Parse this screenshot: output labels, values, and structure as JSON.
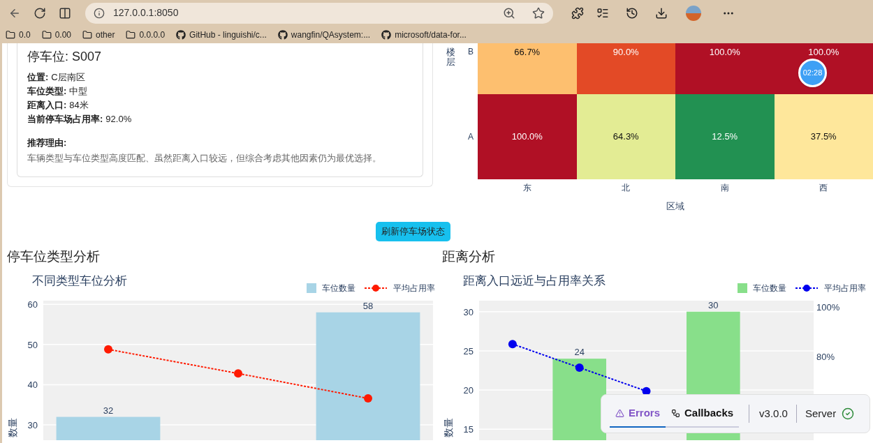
{
  "browser": {
    "url": "127.0.0.1:8050",
    "bookmarks": [
      {
        "kind": "folder",
        "label": "0.0"
      },
      {
        "kind": "folder",
        "label": "0.00"
      },
      {
        "kind": "folder",
        "label": "other"
      },
      {
        "kind": "folder",
        "label": "0.0.0.0"
      },
      {
        "kind": "github",
        "label": "GitHub - linguishi/c..."
      },
      {
        "kind": "github",
        "label": "wangfin/QAsystem:..."
      },
      {
        "kind": "github",
        "label": "microsoft/data-for..."
      }
    ]
  },
  "recommendation": {
    "title": "停车位: S007",
    "fields": [
      {
        "label": "位置:",
        "value": "C层南区"
      },
      {
        "label": "车位类型:",
        "value": "中型"
      },
      {
        "label": "距离入口:",
        "value": "84米"
      },
      {
        "label": "当前停车场占用率:",
        "value": "92.0%"
      }
    ],
    "reason_label": "推荐理由:",
    "reason": "车辆类型与车位类型高度匹配、虽然距离入口较远，但综合考虑其他因素仍为最优选择。"
  },
  "heatmap": {
    "ylabel": "楼层",
    "xlabel": "区域",
    "x_axis_labels": [
      "东",
      "北",
      "南",
      "西"
    ],
    "rows": [
      {
        "label": "B",
        "cells": [
          {
            "text": "66.7%",
            "color": "#fdbf6f"
          },
          {
            "text": "90.0%",
            "color": "#e34a26"
          },
          {
            "text": "100.0%",
            "color": "#b01025"
          },
          {
            "text": "100.0%",
            "color": "#b01025"
          }
        ]
      },
      {
        "label": "A",
        "cells": [
          {
            "text": "100.0%",
            "color": "#b01025"
          },
          {
            "text": "64.3%",
            "color": "#e3ec94"
          },
          {
            "text": "12.5%",
            "color": "#229152"
          },
          {
            "text": "37.5%",
            "color": "#fee79b"
          }
        ]
      }
    ]
  },
  "refresh_button": "刷新停车场状态",
  "sections": [
    {
      "heading": "停车位类型分析",
      "chart_data": {
        "type": "bar",
        "title": "不同类型车位分析",
        "ylabel": "数量",
        "ylim": [
          26.2,
          60.9
        ],
        "yticks": [
          30,
          40,
          50,
          60
        ],
        "grid": true,
        "legend": "top-right",
        "stacked": false,
        "series": [
          {
            "name": "车位数量",
            "type": "bar",
            "color": "#a8d4e6",
            "values": [
              32,
              null,
              58
            ],
            "value_labels": [
              "32",
              null,
              "58"
            ]
          },
          {
            "name": "平均占用率",
            "type": "line",
            "line_style": "dotted",
            "marker": "circle",
            "color": "#ff1a00",
            "values": [
              48.8,
              42.8,
              36.6
            ]
          }
        ]
      }
    },
    {
      "heading": "距离分析",
      "chart_data": {
        "type": "bar",
        "title": "距离入口远近与占用率关系",
        "ylabel": "数量",
        "ylim": [
          13.6,
          31.4
        ],
        "yticks": [
          15,
          20,
          25,
          30
        ],
        "y2ticks": [
          {
            "value": 80,
            "label": "80%"
          },
          {
            "value": 100,
            "label": "100%"
          }
        ],
        "grid": true,
        "legend": "top-right",
        "y2lim": [
          46.2,
          102.5
        ],
        "stacked": false,
        "series": [
          {
            "name": "车位数量",
            "type": "bar",
            "color": "#88df8a",
            "values": [
              null,
              24,
              null,
              30,
              null
            ],
            "value_labels": [
              null,
              "24",
              null,
              "30",
              null
            ]
          },
          {
            "name": "平均占用率",
            "type": "line",
            "axis": "y2",
            "line_style": "dotted",
            "marker": "circle",
            "color": "#0000ee",
            "values": [
              85,
              75.5,
              66,
              null,
              null
            ]
          }
        ]
      }
    }
  ],
  "timer": "02:28",
  "dev_panel": {
    "tabs": [
      {
        "label": "Errors",
        "selected": true
      },
      {
        "label": "Callbacks",
        "selected": false
      }
    ],
    "version": "v3.0.0",
    "server": "Server"
  }
}
